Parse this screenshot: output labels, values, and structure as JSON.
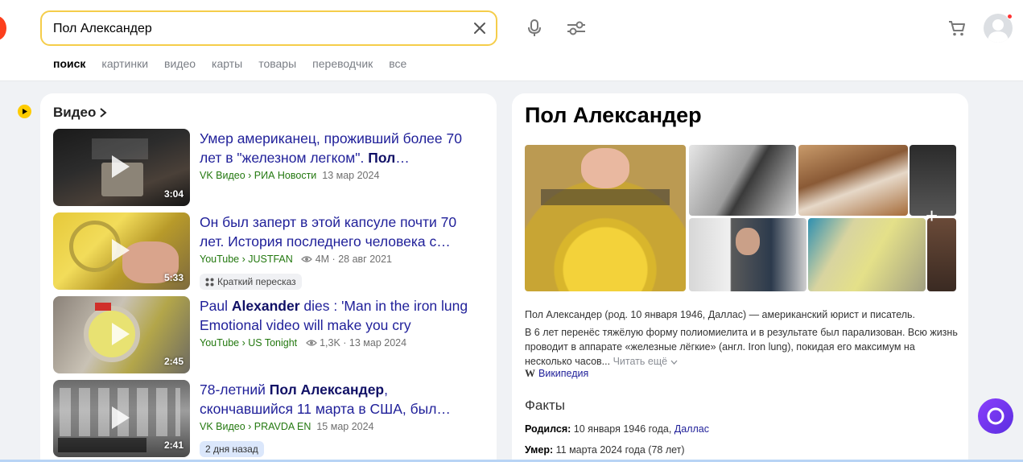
{
  "search": {
    "value": "Пол Александер",
    "placeholder": ""
  },
  "tabs": [
    "поиск",
    "картинки",
    "видео",
    "карты",
    "товары",
    "переводчик",
    "все"
  ],
  "video_section": {
    "heading": "Видео",
    "items": [
      {
        "title_pre": "Умер американец, проживший более 70 лет в \"железном легком\". ",
        "title_bold": "Пол",
        "title_post": "…",
        "duration": "3:04",
        "source": "VK Видео › РИА Новости",
        "views": "",
        "date": "13 мар 2024",
        "chip": ""
      },
      {
        "title_pre": "Он был заперт в этой капсуле почти 70 лет. История последнего человека с…",
        "title_bold": "",
        "title_post": "",
        "duration": "5:33",
        "source": "YouTube › JUSTFAN",
        "views": "4M",
        "date": "28 авг 2021",
        "chip": "Краткий пересказ"
      },
      {
        "title_pre": "Paul ",
        "title_bold": "Alexander",
        "title_post": " dies : 'Man in the iron lung Emotional video will make you cry",
        "duration": "2:45",
        "source": "YouTube › US Tonight",
        "views": "1,3K",
        "date": "13 мар 2024",
        "chip": ""
      },
      {
        "title_pre": "78-летний ",
        "title_bold": "Пол Александер",
        "title_post": ", скончавшийся 11 марта в США, был…",
        "duration": "2:41",
        "source": "VK Видео › PRAVDA EN",
        "views": "",
        "date": "15 мар 2024",
        "chip": "2 дня назад"
      }
    ]
  },
  "entity": {
    "title": "Пол Александер",
    "description_1": "Пол Александер (род. 10 января 1946, Даллас) — американский юрист и писатель.",
    "description_2": "В 6 лет перенёс тяжёлую форму полиомиелита и в результате был парализован. Всю жизнь проводит в аппарате «железные лёгкие» (англ. Iron lung), покидая его максимум на несколько часов...",
    "read_more": "Читать ещё",
    "wiki_label": "Википедия",
    "facts_heading": "Факты",
    "born_label": "Родился:",
    "born_value": "10 января 1946 года,",
    "born_place": "Даллас",
    "died_label": "Умер:",
    "died_value": "11 марта 2024 года (78 лет)"
  },
  "colors": {
    "accent": "#f5cd4a",
    "link": "#1f1f99",
    "source_green": "#23780f",
    "brand_red": "#fc3f1d",
    "alice": "#7b38f5"
  }
}
